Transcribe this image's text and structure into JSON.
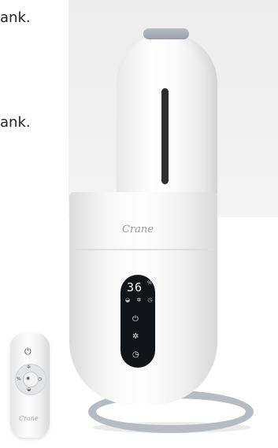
{
  "caption": {
    "line1": "ank.",
    "line2": "ank."
  },
  "product": {
    "brand": "Crane",
    "display": {
      "humidity_value": "36",
      "unit": "%",
      "mini_icons": "◒ ✲ ◷"
    },
    "panel_icons": {
      "power": "⏻",
      "fan": "✲",
      "timer": "◷"
    }
  },
  "remote": {
    "brand": "Crane",
    "power": "⏻",
    "percent": "%",
    "center": "◉",
    "top": "✲",
    "bottom": "◒",
    "right": "◷"
  },
  "colors": {
    "panel": "#111418",
    "stand": "#b7bcc2"
  }
}
